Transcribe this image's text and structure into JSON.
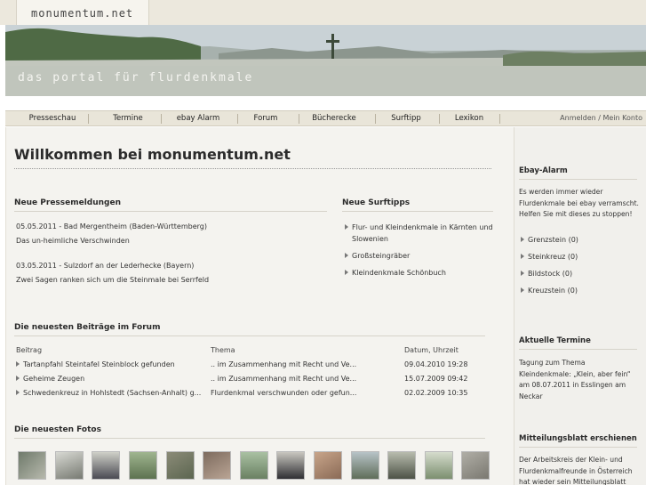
{
  "site": {
    "logo": "monumentum.net",
    "tagline": "das portal für flurdenkmale"
  },
  "nav": {
    "items": [
      "Presseschau",
      "Termine",
      "ebay Alarm",
      "Forum",
      "Bücherecke",
      "Surftipp",
      "Lexikon"
    ],
    "account": "Anmelden / Mein Konto"
  },
  "main": {
    "title": "Willkommen bei monumentum.net",
    "press": {
      "heading": "Neue Pressemeldungen",
      "entries": [
        {
          "date_place": "05.05.2011 - Bad Mergentheim (Baden-Württemberg)",
          "headline": "Das un-heimliche Verschwinden"
        },
        {
          "date_place": "03.05.2011 - Sulzdorf an der Lederhecke (Bayern)",
          "headline": "Zwei Sagen ranken sich um die Steinmale bei Serrfeld"
        }
      ]
    },
    "surftipps": {
      "heading": "Neue Surftipps",
      "items": [
        "Flur- und Kleindenkmale in Kärnten und",
        "Slowenien",
        "Großsteingräber",
        "Kleindenkmale Schönbuch"
      ]
    },
    "forum": {
      "heading": "Die neuesten Beiträge im Forum",
      "columns": [
        "Beitrag",
        "Thema",
        "Datum, Uhrzeit"
      ],
      "rows": [
        [
          "Tartanpfahl Steintafel Steinblock gefunden",
          ".. im Zusammenhang mit Recht und Ve...",
          "09.04.2010 19:28"
        ],
        [
          "Geheime Zeugen",
          ".. im Zusammenhang mit Recht und Ve...",
          "15.07.2009 09:42"
        ],
        [
          "Schwedenkreuz in Hohlstedt (Sachsen-Anhalt) g...",
          "Flurdenkmal verschwunden oder gefun...",
          "02.02.2009 10:35"
        ]
      ]
    },
    "photos": {
      "heading": "Die neuesten Fotos",
      "count": 13
    }
  },
  "sidebar": {
    "ebay": {
      "heading": "Ebay-Alarm",
      "text": "Es werden immer wieder Flurdenkmale bei ebay verramscht. Helfen Sie mit dieses zu stoppen!",
      "links": [
        "Grenzstein (0)",
        "Steinkreuz (0)",
        "Bildstock (0)",
        "Kreuzstein (0)"
      ]
    },
    "termine": {
      "heading": "Aktuelle Termine",
      "text": "Tagung zum Thema Kleindenkmale: „Klein, aber fein“ am 08.07.2011 in Esslingen am Neckar"
    },
    "mitteilung": {
      "heading": "Mitteilungsblatt erschienen",
      "text": "Der Arbeitskreis der Klein- und Flurdenkmalfreunde in Österreich hat wieder sein Mitteilungsblatt"
    }
  }
}
